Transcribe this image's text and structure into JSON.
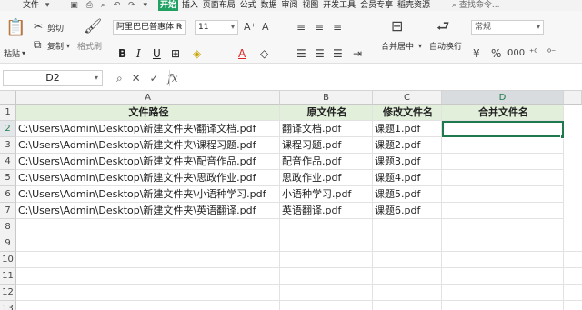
{
  "menubar": {
    "file_label": "文件",
    "tabs": [
      "开始",
      "插入",
      "页面布局",
      "公式",
      "数据",
      "审阅",
      "视图",
      "开发工具",
      "会员专享",
      "稻壳资源"
    ],
    "active_tab": "开始",
    "search_placeholder": "查找命令..."
  },
  "ribbon": {
    "paste_label": "粘贴",
    "cut_label": "剪切",
    "copy_label": "复制",
    "format_painter_label": "格式刷",
    "font_name": "阿里巴巴普惠体 R",
    "font_size": "11",
    "merge_center_label": "合并居中",
    "wrap_text_label": "自动换行",
    "number_format": "常规"
  },
  "formula_bar": {
    "name_box": "D2",
    "formula": ""
  },
  "sheet": {
    "columns": [
      "A",
      "B",
      "C",
      "D"
    ],
    "selected_column": "D",
    "row_numbers": [
      "1",
      "2",
      "3",
      "4",
      "5",
      "6",
      "7",
      "8",
      "9",
      "10",
      "11",
      "12",
      "13"
    ],
    "selected_row": "2",
    "header_row": [
      "文件路径",
      "原文件名",
      "修改文件名",
      "合并文件名"
    ],
    "rows": [
      [
        "C:\\Users\\Admin\\Desktop\\新建文件夹\\翻译文档.pdf",
        "翻译文档.pdf",
        "课题1.pdf",
        ""
      ],
      [
        "C:\\Users\\Admin\\Desktop\\新建文件夹\\课程习题.pdf",
        "课程习题.pdf",
        "课题2.pdf",
        ""
      ],
      [
        "C:\\Users\\Admin\\Desktop\\新建文件夹\\配音作品.pdf",
        "配音作品.pdf",
        "课题3.pdf",
        ""
      ],
      [
        "C:\\Users\\Admin\\Desktop\\新建文件夹\\思政作业.pdf",
        "思政作业.pdf",
        "课题4.pdf",
        ""
      ],
      [
        "C:\\Users\\Admin\\Desktop\\新建文件夹\\小语种学习.pdf",
        "小语种学习.pdf",
        "课题5.pdf",
        ""
      ],
      [
        "C:\\Users\\Admin\\Desktop\\新建文件夹\\英语翻译.pdf",
        "英语翻译.pdf",
        "课题6.pdf",
        ""
      ]
    ]
  },
  "colors": {
    "accent": "#20a162",
    "selection": "#1e7a4c",
    "header_fill": "#e2efda"
  }
}
